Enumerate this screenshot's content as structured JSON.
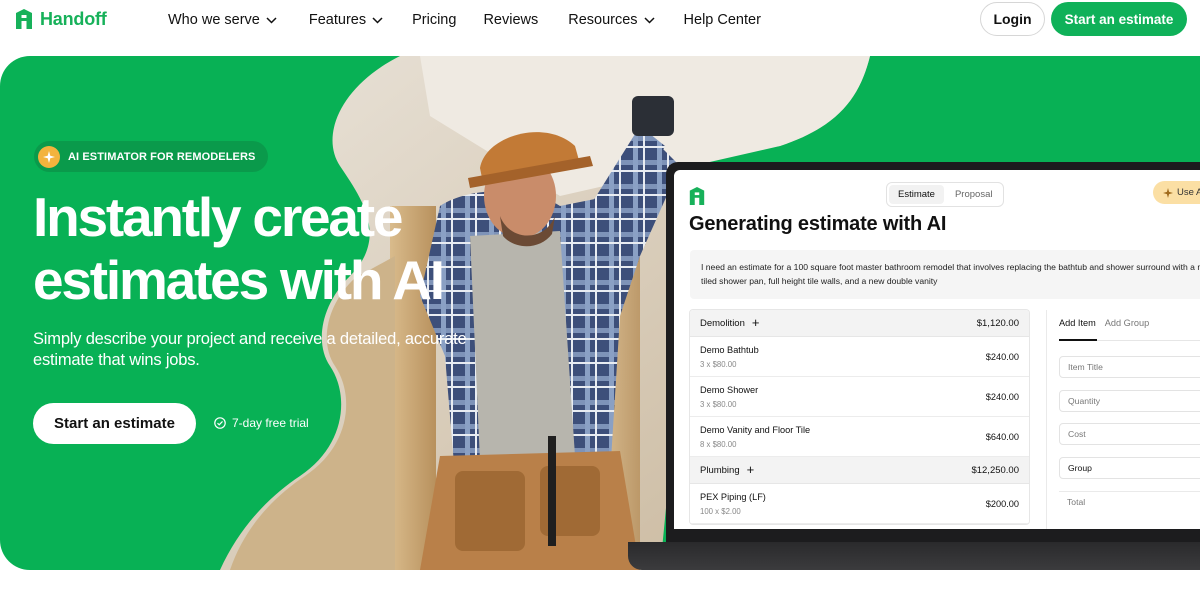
{
  "brand": {
    "name": "Handoff",
    "color": "#0fb159"
  },
  "nav": {
    "links": [
      {
        "label": "Who we serve",
        "dropdown": true
      },
      {
        "label": "Features",
        "dropdown": true
      },
      {
        "label": "Pricing",
        "dropdown": false
      },
      {
        "label": "Reviews",
        "dropdown": false
      },
      {
        "label": "Resources",
        "dropdown": true
      },
      {
        "label": "Help Center",
        "dropdown": false
      }
    ],
    "login_label": "Login",
    "cta_label": "Start an estimate"
  },
  "hero": {
    "badge": "AI ESTIMATOR FOR REMODELERS",
    "title_line1": "Instantly create",
    "title_line2": "estimates with AI",
    "subtitle": "Simply describe your project and receive a detailed, accurate estimate that wins jobs.",
    "cta_label": "Start an estimate",
    "trial_text": "7-day free trial"
  },
  "app": {
    "tabs": [
      "Estimate",
      "Proposal"
    ],
    "active_tab": "Estimate",
    "use_ai_label": "Use AI",
    "title": "Generating estimate with AI",
    "prompt": "I need an estimate for a 100 square foot master bathroom remodel that involves replacing the bathtub and shower surround with a new tiled shower pan, full height tile walls, and a new double vanity",
    "groups": [
      {
        "name": "Demolition",
        "total": "$1,120.00",
        "items": [
          {
            "name": "Demo Bathtub",
            "qty": "3 x $80.00",
            "price": "$240.00"
          },
          {
            "name": "Demo Shower",
            "qty": "3 x $80.00",
            "price": "$240.00"
          },
          {
            "name": "Demo Vanity and Floor Tile",
            "qty": "8 x $80.00",
            "price": "$640.00"
          }
        ]
      },
      {
        "name": "Plumbing",
        "total": "$12,250.00",
        "items": [
          {
            "name": "PEX Piping (LF)",
            "qty": "100 x $2.00",
            "price": "$200.00"
          }
        ]
      }
    ],
    "panel": {
      "tabs": [
        "Add Item",
        "Add Group"
      ],
      "fields": {
        "item_title": "Item Title",
        "quantity": "Quantity",
        "cost": "Cost",
        "group": "Group",
        "total": "Total"
      }
    }
  }
}
